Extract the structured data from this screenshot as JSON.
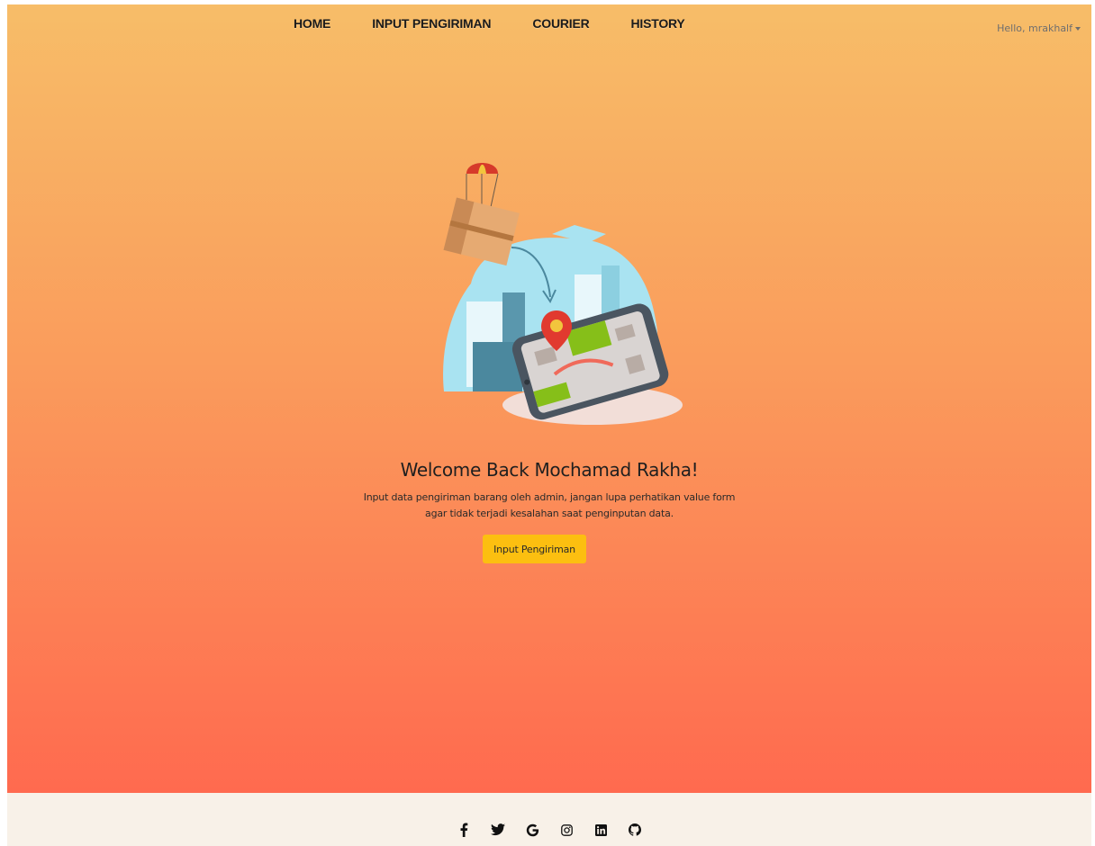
{
  "nav": {
    "items": [
      {
        "label": "HOME"
      },
      {
        "label": "INPUT PENGIRIMAN"
      },
      {
        "label": "COURIER"
      },
      {
        "label": "HISTORY"
      }
    ],
    "user_greeting": "Hello, mrakhalf"
  },
  "hero": {
    "title": "Welcome Back Mochamad Rakha!",
    "description": "Input data pengiriman barang oleh admin, jangan lupa perhatikan value form agar tidak terjadi kesalahan saat penginputan data.",
    "cta_label": "Input Pengiriman",
    "illustration": "parcel-delivery-illustration"
  },
  "footer": {
    "social_icons": [
      "facebook-icon",
      "twitter-icon",
      "google-icon",
      "instagram-icon",
      "linkedin-icon",
      "github-icon"
    ]
  },
  "colors": {
    "gradient_top": "#f7bd68",
    "gradient_bottom": "#ff6a4f",
    "button": "#fcbf10",
    "footer_bg": "#f8f1e8"
  }
}
